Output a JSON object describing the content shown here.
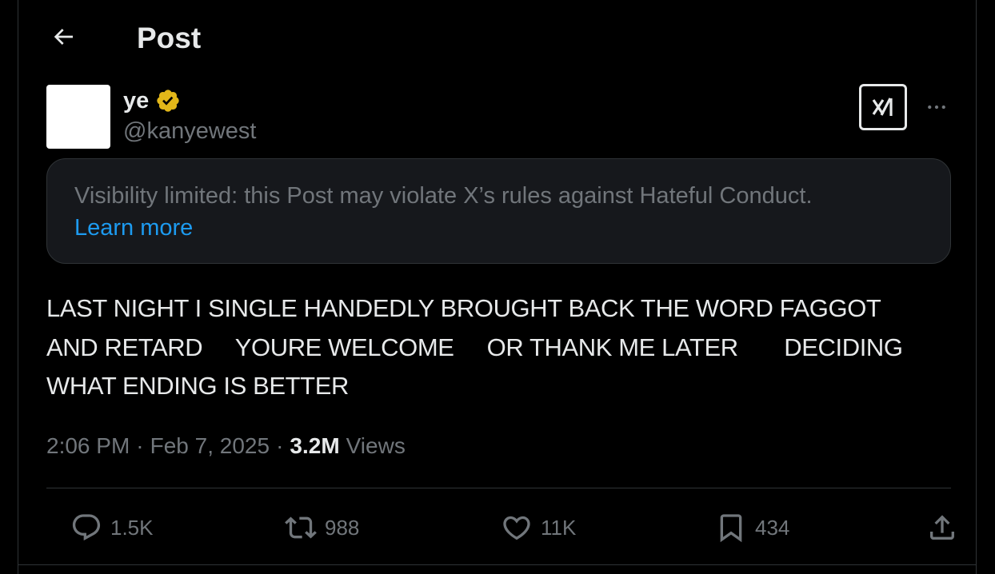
{
  "header": {
    "back_icon": "arrow-left-icon",
    "title": "Post"
  },
  "post": {
    "author": {
      "name": "ye",
      "handle": "@kanyewest",
      "verified": true,
      "verified_color": "#e2b719"
    },
    "notice": {
      "text": "Visibility limited: this Post may violate X’s rules against Hateful Conduct.",
      "link_label": "Learn more"
    },
    "body": "LAST NIGHT I SINGLE HANDEDLY BROUGHT BACK THE WORD FAGGOT\nAND RETARD     YOURE WELCOME     OR THANK ME LATER       DECIDING\nWHAT ENDING IS BETTER",
    "meta": {
      "time": "2:06 PM",
      "separator": "·",
      "date": "Feb 7, 2025",
      "views_count": "3.2M",
      "views_label": "Views"
    },
    "actions": {
      "replies": "1.5K",
      "reposts": "988",
      "likes": "11K",
      "bookmarks": "434"
    }
  },
  "colors": {
    "background": "#000000",
    "text_primary": "#e7e9ea",
    "text_secondary": "#71767b",
    "link": "#1d9bf0",
    "border": "#2f3336",
    "notice_bg": "#16181c"
  }
}
